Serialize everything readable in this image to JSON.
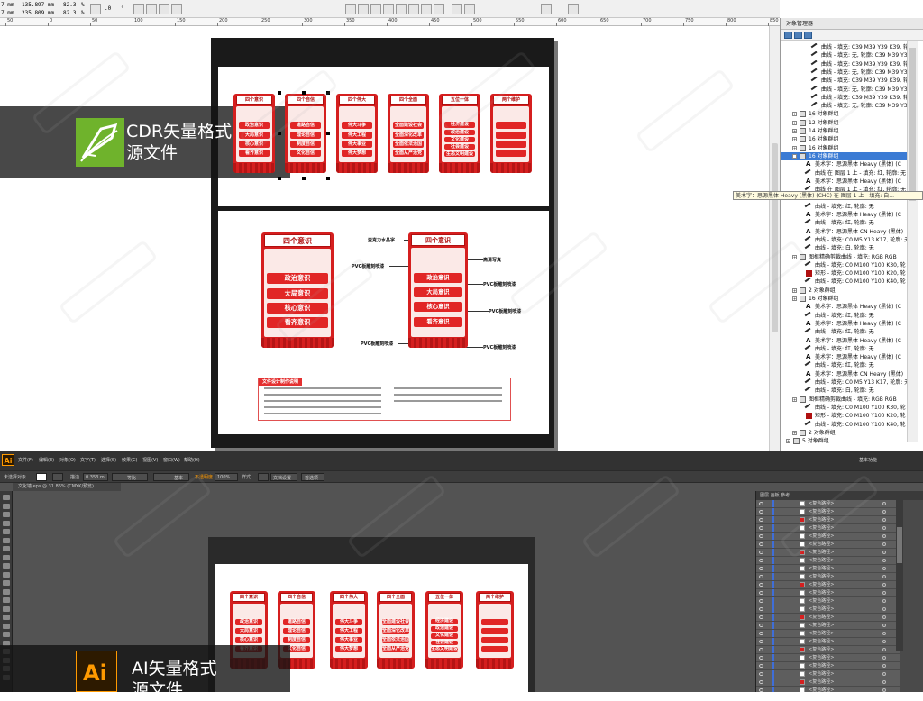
{
  "cdr": {
    "prop_bar": {
      "field1": "7 mm",
      "field2": "7 mm",
      "x": "135.897 mm",
      "y": "235.809 mm",
      "sx": "82.3",
      "sy": "82.3",
      "pct1": "%",
      "pct2": "%",
      "angle": ".0",
      "deg": "°"
    },
    "ruler_ticks": [
      "50",
      "0",
      "50",
      "100",
      "150",
      "200",
      "250",
      "300",
      "350",
      "400",
      "450",
      "500",
      "550",
      "600",
      "650",
      "700",
      "750",
      "800",
      "850",
      "900"
    ],
    "banner": {
      "line1": "CDR矢量格式",
      "line2": "源文件"
    },
    "top_panels": [
      {
        "title": "四个意识",
        "items": [
          "政治意识",
          "大局意识",
          "核心意识",
          "看齐意识"
        ]
      },
      {
        "title": "四个自信",
        "items": [
          "道路自信",
          "理论自信",
          "制度自信",
          "文化自信"
        ]
      },
      {
        "title": "四个伟大",
        "items": [
          "伟大斗争",
          "伟大工程",
          "伟大事业",
          "伟大梦想"
        ]
      },
      {
        "title": "四个全面",
        "items": [
          "全面建设社会",
          "全面深化改革",
          "全面依法治国",
          "全面从严治党"
        ]
      },
      {
        "title": "五位一体",
        "items": [
          "经济建设",
          "政治建设",
          "文化建设",
          "社会建设",
          "生态文明建设"
        ]
      },
      {
        "title": "两个维护",
        "items": [
          "",
          "",
          "",
          ""
        ]
      }
    ],
    "detail_panel": {
      "title": "四个意识",
      "items": [
        "政治意识",
        "大局意识",
        "核心意识",
        "看齐意识"
      ]
    },
    "callouts": {
      "c1": "亚克力水晶字",
      "c2": "PVC板雕刻喷漆",
      "c3": "高清写真",
      "c4": "PVC板雕刻喷漆",
      "c5": "PVC板雕刻喷漆",
      "c6": "PVC板雕刻喷漆",
      "c7": "PVC板雕刻喷漆"
    },
    "design_box_title": "文件设计制作说明"
  },
  "objmgr": {
    "title": "对象管理器",
    "tooltip": "美术字：思源黑体 Heavy (黑体) (CHC) 在 图层 1 上 - 填充: 白...",
    "rows": [
      {
        "indent": 3,
        "icon": "curve",
        "label": "曲线 - 填充: C39 M39 Y39 K39, 轮廓: 无"
      },
      {
        "indent": 3,
        "icon": "curve",
        "label": "曲线 - 填充: 无, 轮廓: C39 M39 Y39 K"
      },
      {
        "indent": 3,
        "icon": "curve",
        "label": "曲线 - 填充: C39 M39 Y39 K39, 轮廓: 无"
      },
      {
        "indent": 3,
        "icon": "curve",
        "label": "曲线 - 填充: 无, 轮廓: C39 M39 Y39 K"
      },
      {
        "indent": 3,
        "icon": "curve",
        "label": "曲线 - 填充: C39 M39 Y39 K39, 轮廓: 无"
      },
      {
        "indent": 3,
        "icon": "curve",
        "label": "曲线 - 填充: 无, 轮廓: C39 M39 Y39 K"
      },
      {
        "indent": 3,
        "icon": "curve",
        "label": "曲线 - 填充: C39 M39 Y39 K39, 轮廓: 无"
      },
      {
        "indent": 3,
        "icon": "curve",
        "label": "曲线 - 填充: 无, 轮廓: C39 M39 Y39 K"
      },
      {
        "indent": 1,
        "icon": "group",
        "label": "16 对象群组"
      },
      {
        "indent": 1,
        "icon": "group",
        "label": "12 对象群组"
      },
      {
        "indent": 1,
        "icon": "group",
        "label": "14 对象群组"
      },
      {
        "indent": 1,
        "icon": "group",
        "label": "16 对象群组"
      },
      {
        "indent": 1,
        "icon": "group",
        "label": "16 对象群组"
      },
      {
        "indent": 1,
        "icon": "group",
        "label": "16 对象群组",
        "selected": true
      },
      {
        "indent": 2,
        "icon": "text",
        "label": "美术字：思源黑体 Heavy (黑体) (C"
      },
      {
        "indent": 2,
        "icon": "curve",
        "label": "曲线 在 图层 1 上 - 填充: 红, 轮廓: 无"
      },
      {
        "indent": 2,
        "icon": "text",
        "label": "美术字：思源黑体 Heavy (黑体) (C"
      },
      {
        "indent": 2,
        "icon": "curve",
        "label": "曲线 在 图层 1 上 - 填充: 红, 轮廓: 无"
      },
      {
        "indent": 2,
        "icon": "blank",
        "label": ""
      },
      {
        "indent": 2,
        "icon": "curve",
        "label": "曲线 - 填充: 红, 轮廓: 无"
      },
      {
        "indent": 2,
        "icon": "text",
        "label": "美术字：思源黑体 Heavy (黑体) (C"
      },
      {
        "indent": 2,
        "icon": "curve",
        "label": "曲线 - 填充: 红, 轮廓: 无"
      },
      {
        "indent": 2,
        "icon": "text",
        "label": "美术字：思源黑体 CN Heavy (黑体)"
      },
      {
        "indent": 2,
        "icon": "curve",
        "label": "曲线 - 填充: C0 M5 Y13 K17, 轮廓: 无"
      },
      {
        "indent": 2,
        "icon": "curve",
        "label": "曲线 - 填充: 白, 轮廓: 无"
      },
      {
        "indent": 1,
        "icon": "pc",
        "label": "图框精确剪裁曲线 - 填充: RGB RGB"
      },
      {
        "indent": 2,
        "icon": "curve",
        "label": "曲线 - 填充: C0 M100 Y100 K30, 轮"
      },
      {
        "indent": 2,
        "icon": "rect",
        "label": "矩形 - 填充: C0 M100 Y100 K20, 轮"
      },
      {
        "indent": 2,
        "icon": "curve",
        "label": "曲线 - 填充: C0 M100 Y100 K40, 轮"
      },
      {
        "indent": 1,
        "icon": "group",
        "label": "2 对象群组"
      },
      {
        "indent": 1,
        "icon": "group",
        "label": "16 对象群组"
      },
      {
        "indent": 2,
        "icon": "text",
        "label": "美术字：思源黑体 Heavy (黑体) (C"
      },
      {
        "indent": 2,
        "icon": "curve",
        "label": "曲线 - 填充: 红, 轮廓: 无"
      },
      {
        "indent": 2,
        "icon": "text",
        "label": "美术字：思源黑体 Heavy (黑体) (C"
      },
      {
        "indent": 2,
        "icon": "curve",
        "label": "曲线 - 填充: 红, 轮廓: 无"
      },
      {
        "indent": 2,
        "icon": "text",
        "label": "美术字：思源黑体 Heavy (黑体) (C"
      },
      {
        "indent": 2,
        "icon": "curve",
        "label": "曲线 - 填充: 红, 轮廓: 无"
      },
      {
        "indent": 2,
        "icon": "text",
        "label": "美术字：思源黑体 Heavy (黑体) (C"
      },
      {
        "indent": 2,
        "icon": "curve",
        "label": "曲线 - 填充: 红, 轮廓: 无"
      },
      {
        "indent": 2,
        "icon": "text",
        "label": "美术字：思源黑体 CN Heavy (黑体)"
      },
      {
        "indent": 2,
        "icon": "curve",
        "label": "曲线 - 填充: C0 M5 Y13 K17, 轮廓: 无"
      },
      {
        "indent": 2,
        "icon": "curve",
        "label": "曲线 - 填充: 白, 轮廓: 无"
      },
      {
        "indent": 1,
        "icon": "pc",
        "label": "图框精确剪裁曲线 - 填充: RGB RGB"
      },
      {
        "indent": 2,
        "icon": "curve",
        "label": "曲线 - 填充: C0 M100 Y100 K30, 轮"
      },
      {
        "indent": 2,
        "icon": "rect",
        "label": "矩形 - 填充: C0 M100 Y100 K20, 轮"
      },
      {
        "indent": 2,
        "icon": "curve",
        "label": "曲线 - 填充: C0 M100 Y100 K40, 轮"
      },
      {
        "indent": 1,
        "icon": "group",
        "label": "2 对象群组"
      },
      {
        "indent": 0,
        "icon": "group",
        "label": "5 对象群组"
      }
    ]
  },
  "ai": {
    "menu": [
      "文件(F)",
      "编辑(E)",
      "对象(O)",
      "文字(T)",
      "选择(S)",
      "效果(C)",
      "视图(V)",
      "窗口(W)",
      "帮助(H)"
    ],
    "workspace": "基本功能",
    "ctrl": {
      "sel": "未选择对象",
      "stroke_label": "描边",
      "stroke_val": "0.353 m",
      "uniform": "等比",
      "basic": "基本",
      "opacity_label": "不透明度",
      "opacity": "100%",
      "style": "样式",
      "doc_setup": "文档设置",
      "prefs": "首选项"
    },
    "doc_tab": "文化墙.eps @ 31.86% (CMYK/预览)",
    "layers_tabs": "图层   画板 参考",
    "layer_label": "<复合路径>",
    "banner": {
      "line1": "AI矢量格式",
      "line2": "源文件"
    },
    "panels": [
      {
        "title": "四个意识",
        "items": [
          "政治意识",
          "大局意识",
          "核心意识",
          "看齐意识"
        ]
      },
      {
        "title": "四个自信",
        "items": [
          "道路自信",
          "理论自信",
          "制度自信",
          "文化自信"
        ]
      },
      {
        "title": "四个伟大",
        "items": [
          "伟大斗争",
          "伟大工程",
          "伟大事业",
          "伟大梦想"
        ]
      },
      {
        "title": "四个全面",
        "items": [
          "全面建设社会",
          "全面深化改革",
          "全面依法治国",
          "全面从严治党"
        ]
      },
      {
        "title": "五位一体",
        "items": [
          "经济建设",
          "政治建设",
          "文化建设",
          "社会建设",
          "生态文明建设"
        ]
      },
      {
        "title": "两个维护",
        "items": [
          "",
          "",
          "",
          ""
        ]
      }
    ]
  },
  "colors": {
    "accent_red": "#d51f1f",
    "cdr_green": "#6fb32c",
    "ai_orange": "#ff9a00"
  },
  "icons": [
    "coreldraw-logo-icon",
    "illustrator-logo-icon",
    "group-icon",
    "curve-icon",
    "text-icon",
    "rect-icon",
    "expand-toggle-icon",
    "eye-icon"
  ]
}
